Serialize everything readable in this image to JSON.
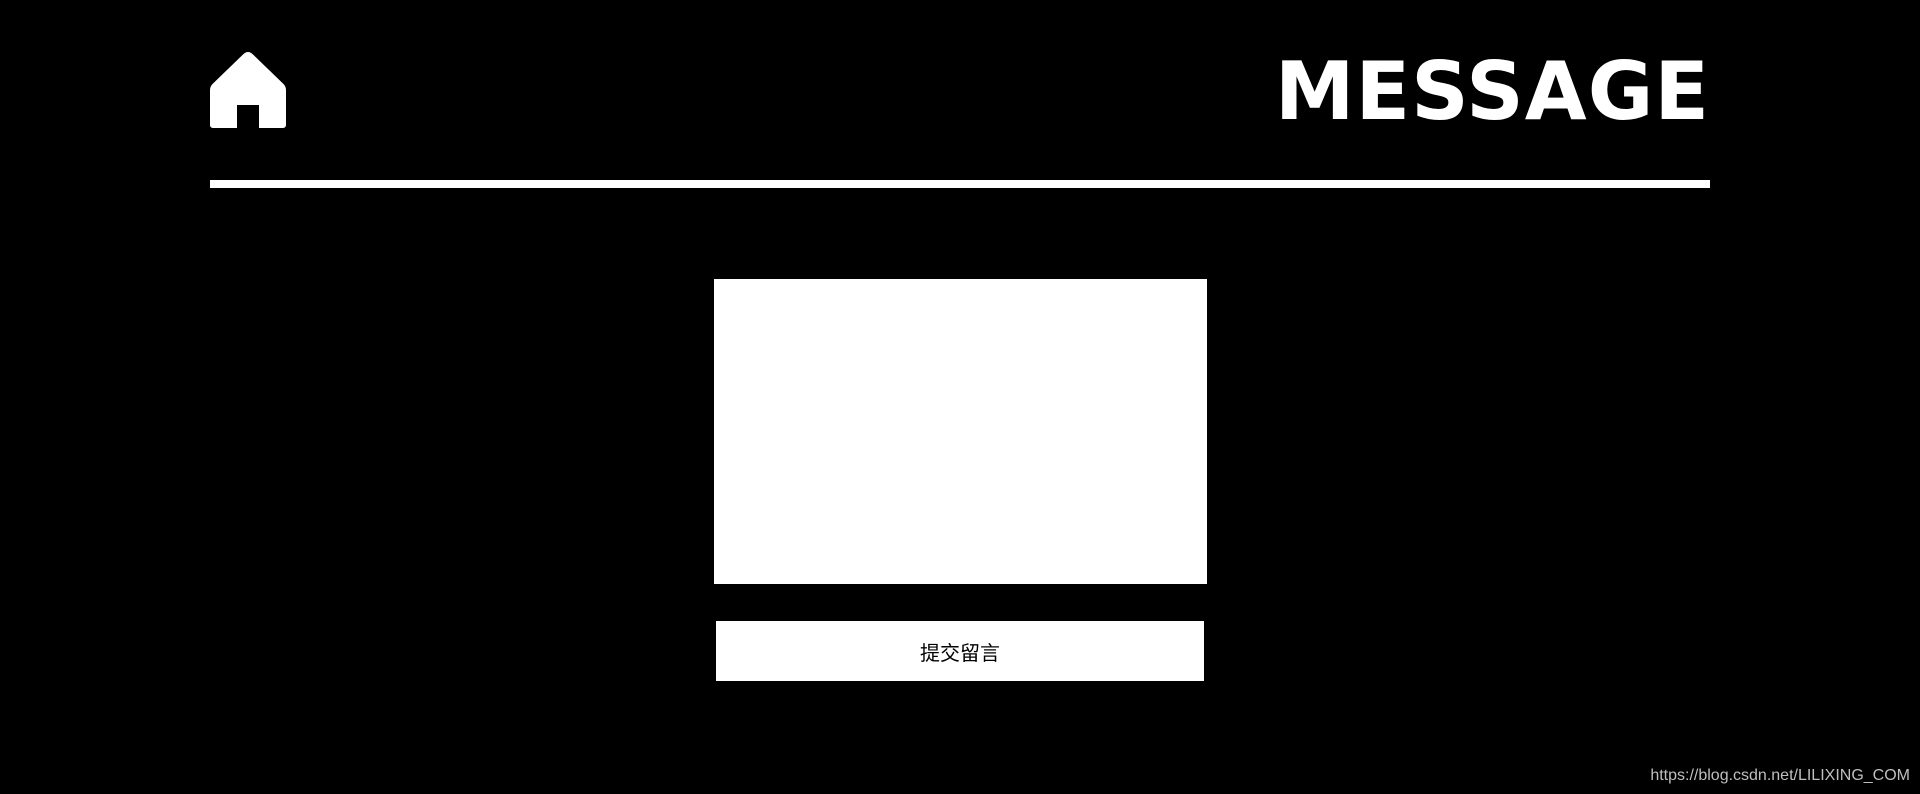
{
  "header": {
    "home_icon": "home-icon",
    "title": "MESSAGE"
  },
  "form": {
    "message_value": "",
    "message_placeholder": "",
    "submit_label": "提交留言"
  },
  "footer": {
    "watermark": "https://blog.csdn.net/LILIXING_COM"
  },
  "colors": {
    "background": "#000000",
    "foreground": "#ffffff",
    "button_text": "#000000",
    "watermark": "#bfbfbf"
  }
}
